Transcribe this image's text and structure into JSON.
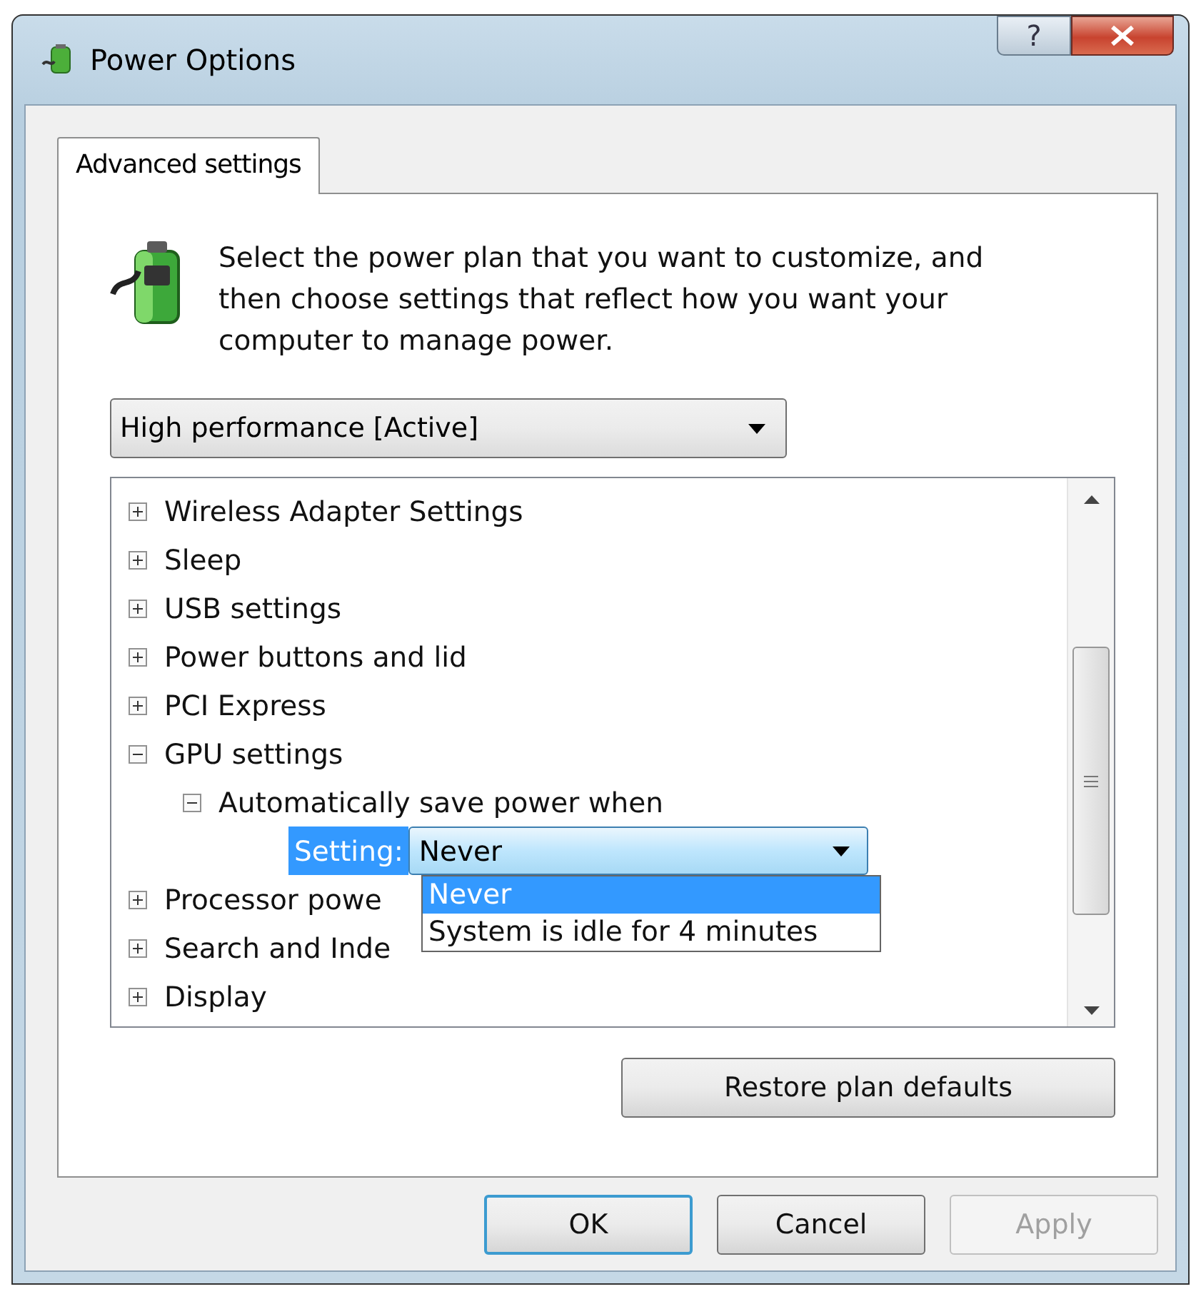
{
  "window": {
    "title": "Power Options",
    "help_button": "?"
  },
  "tabs": [
    {
      "label": "Advanced settings",
      "selected": true
    }
  ],
  "description": "Select the power plan that you want to customize, and then choose settings that reflect how you want your computer to manage power.",
  "plan_select": {
    "value": "High performance [Active]"
  },
  "tree": {
    "items": [
      {
        "label": "Wireless Adapter Settings",
        "expanded": false
      },
      {
        "label": "Sleep",
        "expanded": false
      },
      {
        "label": "USB settings",
        "expanded": false
      },
      {
        "label": "Power buttons and lid",
        "expanded": false
      },
      {
        "label": "PCI Express",
        "expanded": false
      },
      {
        "label": "GPU settings",
        "expanded": true,
        "children": [
          {
            "label": "Automatically save power when",
            "expanded": true,
            "setting": {
              "label": "Setting:",
              "value": "Never",
              "selected": true
            }
          }
        ]
      },
      {
        "label": "Processor powe",
        "expanded": false
      },
      {
        "label": "Search and Inde",
        "expanded": false
      },
      {
        "label": "Display",
        "expanded": false
      }
    ],
    "dropdown_options": [
      {
        "label": "Never",
        "selected": true
      },
      {
        "label": "System is idle for 4 minutes",
        "selected": false
      }
    ]
  },
  "restore_button": "Restore plan defaults",
  "buttons": [
    {
      "label": "OK",
      "default": true,
      "disabled": false
    },
    {
      "label": "Cancel",
      "default": false,
      "disabled": false
    },
    {
      "label": "Apply",
      "default": false,
      "disabled": true
    }
  ]
}
